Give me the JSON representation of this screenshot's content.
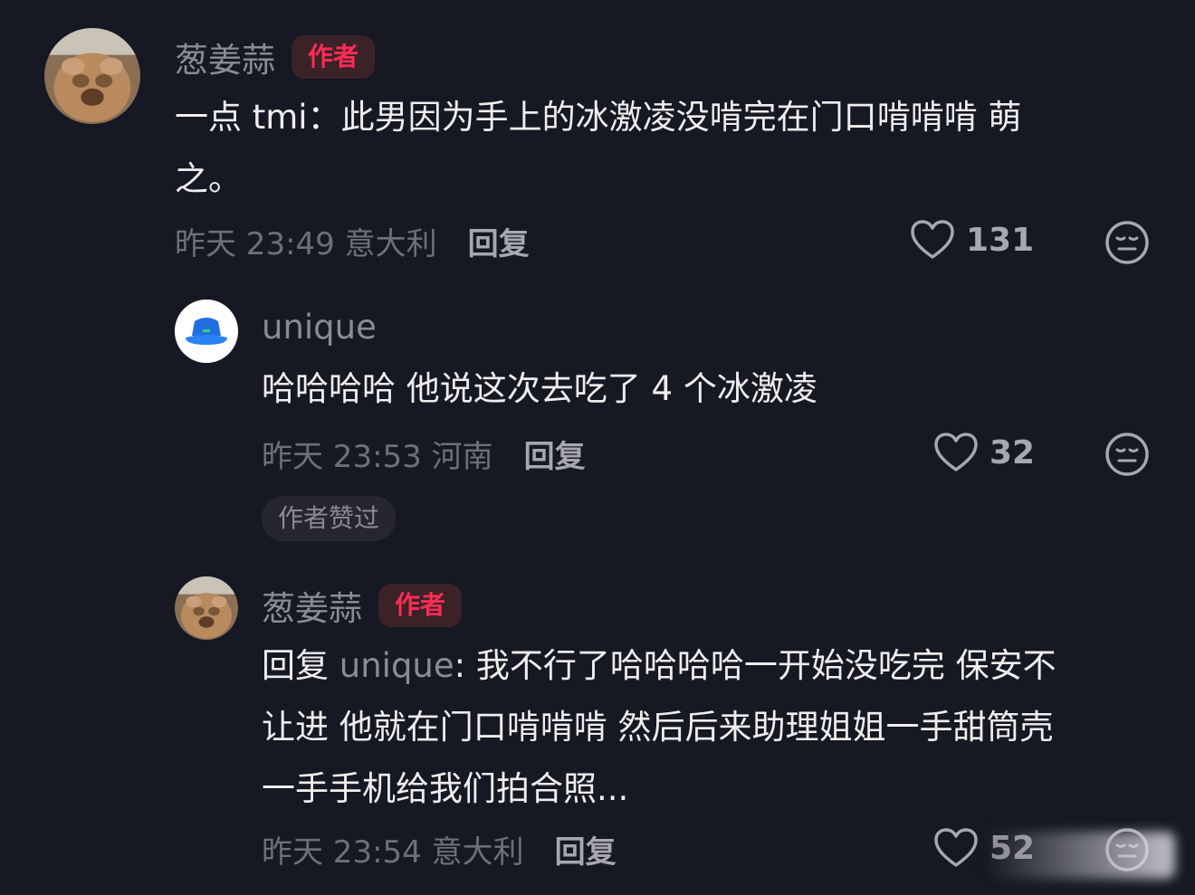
{
  "comments": [
    {
      "username": "葱姜蒜",
      "badge": "作者",
      "text_line1": "一点 tmi：此男因为手上的冰激凌没啃完在门口啃啃啃 萌",
      "text_line2": "之。",
      "meta": "昨天 23:49 意大利",
      "reply_label": "回复",
      "likes": "131",
      "avatar_icon": "dog-avatar"
    },
    {
      "username": "unique",
      "text": "哈哈哈哈 他说这次去吃了 4 个冰激凌",
      "meta": "昨天 23:53 河南",
      "reply_label": "回复",
      "likes": "32",
      "liked_by_author": "作者赞过",
      "avatar_icon": "bucket-hat-avatar"
    },
    {
      "username": "葱姜蒜",
      "badge": "作者",
      "reply_prefix": "回复",
      "mention": "unique",
      "text_line1_rest": ": 我不行了哈哈哈哈一开始没吃完 保安不",
      "text_line2": "让进 他就在门口啃啃啃 然后后来助理姐姐一手甜筒壳",
      "text_line3": "一手手机给我们拍合照...",
      "meta": "昨天 23:54 意大利",
      "reply_label": "回复",
      "likes": "52",
      "avatar_icon": "dog-avatar"
    }
  ],
  "colors": {
    "background": "#161823",
    "author_badge": "#fe2c55",
    "secondary_text": "#8b8c91"
  },
  "icons": [
    "heart-outline-icon",
    "dislike-face-icon"
  ]
}
